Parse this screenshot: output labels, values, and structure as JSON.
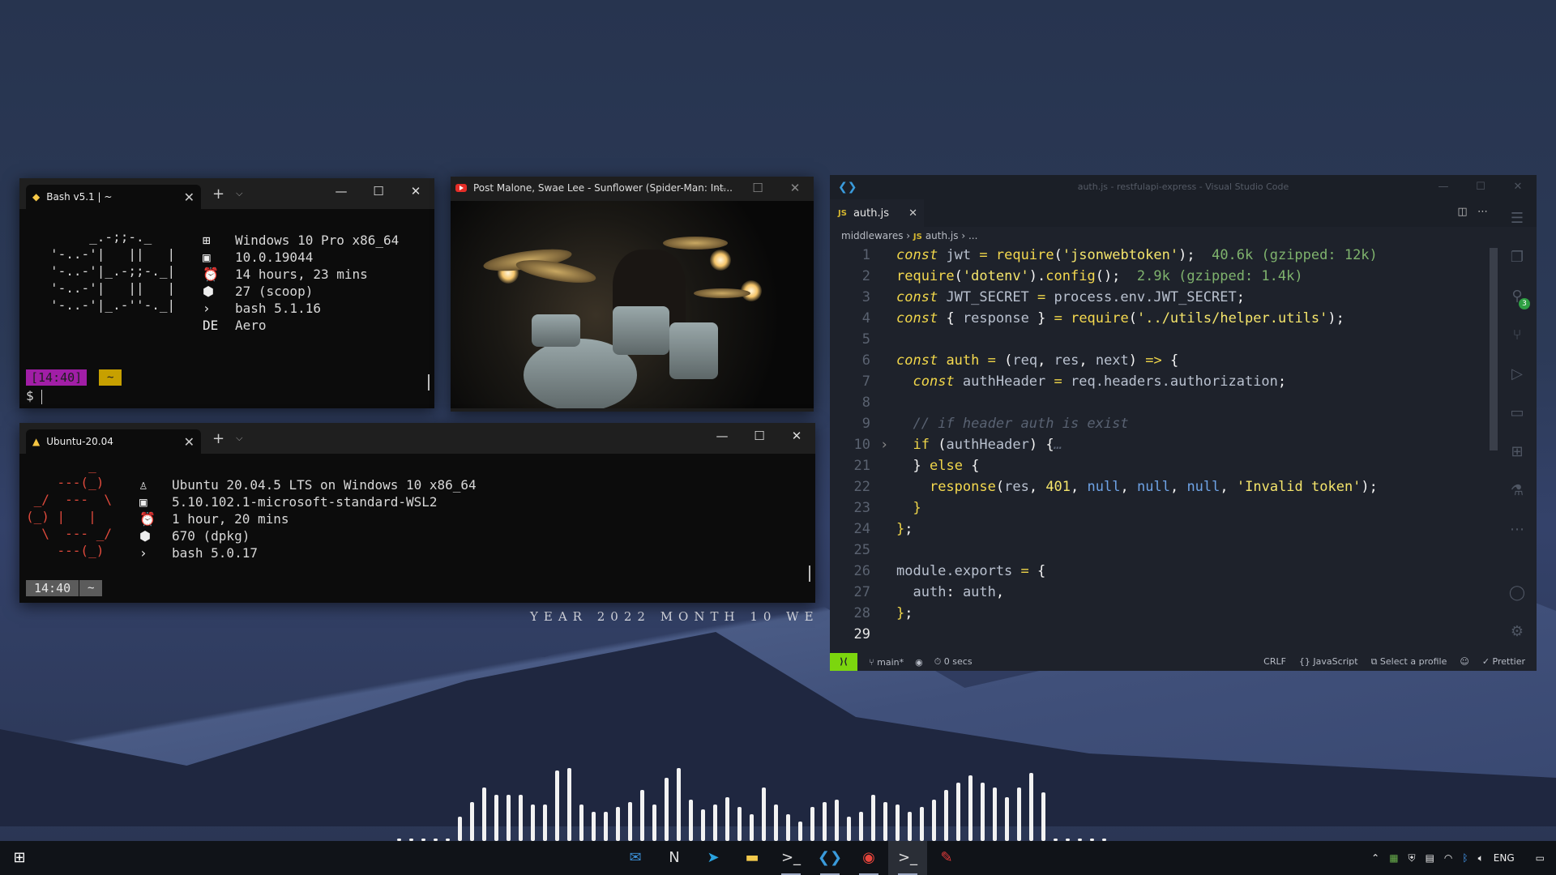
{
  "wallpaper": {
    "date_line": "YEAR 2022   MONTH 10   WE"
  },
  "bash_window": {
    "tab_title": "Bash v5.1 | ~",
    "ascii_logo": "     _.-;;-._\n'-..-'|   ||   |\n'-..-'|_.-;;-._|\n'-..-'|   ||   |\n'-..-'|_.-''-._|",
    "info": [
      {
        "icon": "windows-icon",
        "glyph": "⊞",
        "text": "Windows 10 Pro x86_64"
      },
      {
        "icon": "kernel-icon",
        "glyph": "▣",
        "text": "10.0.19044"
      },
      {
        "icon": "uptime-icon",
        "glyph": "⏰",
        "text": "14 hours, 23 mins"
      },
      {
        "icon": "package-icon",
        "glyph": "⬢",
        "text": "27 (scoop)"
      },
      {
        "icon": "shell-icon",
        "glyph": "›",
        "text": "bash 5.1.16"
      },
      {
        "icon": "de-label",
        "glyph": "DE",
        "text": "Aero"
      }
    ],
    "prompt_time": "[14:40]",
    "prompt_dir": "~",
    "prompt_symbol": "$"
  },
  "video_window": {
    "title": "Post Malone, Swae Lee - Sunflower (Spider-Man: Int..."
  },
  "ubuntu_window": {
    "tab_title": "Ubuntu-20.04",
    "ascii_logo": "        _\n    ---(_)\n _/  ---  \\\n(_) |   |\n  \\  --- _/\n    ---(_)",
    "info": [
      {
        "icon": "linux-icon",
        "glyph": "♙",
        "text": "Ubuntu 20.04.5 LTS on Windows 10 x86_64"
      },
      {
        "icon": "kernel-icon",
        "glyph": "▣",
        "text": "5.10.102.1-microsoft-standard-WSL2"
      },
      {
        "icon": "uptime-icon",
        "glyph": "⏰",
        "text": "1 hour, 20 mins"
      },
      {
        "icon": "package-icon",
        "glyph": "⬢",
        "text": "670 (dpkg)"
      },
      {
        "icon": "shell-icon",
        "glyph": "›",
        "text": "bash 5.0.17"
      }
    ],
    "prompt_time": "14:40",
    "prompt_dir": "~"
  },
  "vscode": {
    "title": "auth.js - restfulapi-express - Visual Studio Code",
    "tab_label": "auth.js",
    "tab_lang": "JS",
    "breadcrumb": [
      "middlewares",
      "auth.js",
      "..."
    ],
    "code_lines": [
      {
        "n": "1",
        "html": "<span class='kw'>const</span> <span class='vr'>jwt</span> <span class='op'>=</span> <span class='fn'>require</span><span class='pn'>(</span><span class='st'>'jsonwebtoken'</span><span class='pn'>);</span>  <span class='ghost'>40.6k (gzipped: 12k)</span>"
      },
      {
        "n": "2",
        "html": "<span class='fn'>require</span><span class='pn'>(</span><span class='st'>'dotenv'</span><span class='pn'>).</span><span class='fn'>config</span><span class='pn'>();</span>  <span class='ghost'>2.9k (gzipped: 1.4k)</span>"
      },
      {
        "n": "3",
        "html": "<span class='kw'>const</span> <span class='vr'>JWT_SECRET</span> <span class='op'>=</span> <span class='vr'>process.env.JWT_SECRET</span><span class='pn'>;</span>"
      },
      {
        "n": "4",
        "html": "<span class='kw'>const</span> <span class='pn'>{</span> <span class='vr'>response</span> <span class='pn'>}</span> <span class='op'>=</span> <span class='fn'>require</span><span class='pn'>(</span><span class='st'>'../utils/helper.utils'</span><span class='pn'>);</span>"
      },
      {
        "n": "5",
        "html": ""
      },
      {
        "n": "6",
        "html": "<span class='kw'>const</span> <span class='fn'>auth</span> <span class='op'>=</span> <span class='pn'>(</span><span class='vr'>req</span><span class='pn'>,</span> <span class='vr'>res</span><span class='pn'>,</span> <span class='vr'>next</span><span class='pn'>)</span> <span class='op'>=&gt;</span> <span class='pn'>{</span>"
      },
      {
        "n": "7",
        "html": "  <span class='kw'>const</span> <span class='vr'>authHeader</span> <span class='op'>=</span> <span class='vr'>req.headers.authorization</span><span class='pn'>;</span>"
      },
      {
        "n": "8",
        "html": ""
      },
      {
        "n": "9",
        "html": "  <span class='cm'>// if header auth is exist</span>"
      },
      {
        "n": "10",
        "html": "  <span class='kw' style='font-style:normal'>if</span> <span class='pn'>(</span><span class='vr'>authHeader</span><span class='pn'>)</span> <span class='pn'>{</span><span class='cm'>…</span>"
      },
      {
        "n": "21",
        "html": "  <span class='pn'>}</span> <span class='kw' style='font-style:normal'>else</span> <span class='pn'>{</span>"
      },
      {
        "n": "22",
        "html": "    <span class='fn'>response</span><span class='pn'>(</span><span class='vr'>res</span><span class='pn'>,</span> <span class='num'>401</span><span class='pn'>,</span> <span class='nul'>null</span><span class='pn'>,</span> <span class='nul'>null</span><span class='pn'>,</span> <span class='nul'>null</span><span class='pn'>,</span> <span class='st'>'Invalid token'</span><span class='pn'>);</span>"
      },
      {
        "n": "23",
        "html": "  <span class='op'>}</span>"
      },
      {
        "n": "24",
        "html": "<span class='op'>}</span><span class='pn'>;</span>"
      },
      {
        "n": "25",
        "html": ""
      },
      {
        "n": "26",
        "html": "<span class='vr'>module.exports</span> <span class='op'>=</span> <span class='pn'>{</span>"
      },
      {
        "n": "27",
        "html": "  <span class='vr'>auth</span><span class='pn'>:</span> <span class='vr'>auth</span><span class='pn'>,</span>"
      },
      {
        "n": "28",
        "html": "<span class='op'>}</span><span class='pn'>;</span>"
      },
      {
        "n": "29",
        "html": ""
      }
    ],
    "status": {
      "branch": "main*",
      "time": "0 secs",
      "eol": "CRLF",
      "language": "JavaScript",
      "profile": "Select a profile",
      "formatter": "Prettier"
    },
    "scm_badge": "3"
  },
  "visualizer_bars": [
    2,
    2,
    2,
    2,
    2,
    20,
    32,
    44,
    38,
    38,
    38,
    30,
    30,
    58,
    60,
    30,
    24,
    24,
    28,
    32,
    42,
    30,
    52,
    60,
    34,
    26,
    30,
    36,
    28,
    22,
    44,
    30,
    22,
    16,
    28,
    32,
    34,
    20,
    24,
    38,
    32,
    30,
    24,
    28,
    34,
    42,
    48,
    54,
    48,
    44,
    36,
    44,
    56,
    40,
    2,
    2,
    2,
    2,
    2
  ],
  "taskbar": {
    "apps": [
      {
        "name": "taskbar-outlook",
        "glyph": "✉",
        "running": false
      },
      {
        "name": "taskbar-notion",
        "glyph": "N",
        "running": false
      },
      {
        "name": "taskbar-telegram",
        "glyph": "➤",
        "running": false
      },
      {
        "name": "taskbar-explorer",
        "glyph": "▬",
        "running": false
      },
      {
        "name": "taskbar-terminal",
        "glyph": ">_",
        "running": true
      },
      {
        "name": "taskbar-vscode",
        "glyph": "❮❯",
        "running": true
      },
      {
        "name": "taskbar-chrome",
        "glyph": "◉",
        "running": true
      },
      {
        "name": "taskbar-terminal-2",
        "glyph": ">_",
        "running": true
      },
      {
        "name": "taskbar-app-red",
        "glyph": "✎",
        "running": false
      }
    ],
    "tray_lang": "ENG"
  }
}
